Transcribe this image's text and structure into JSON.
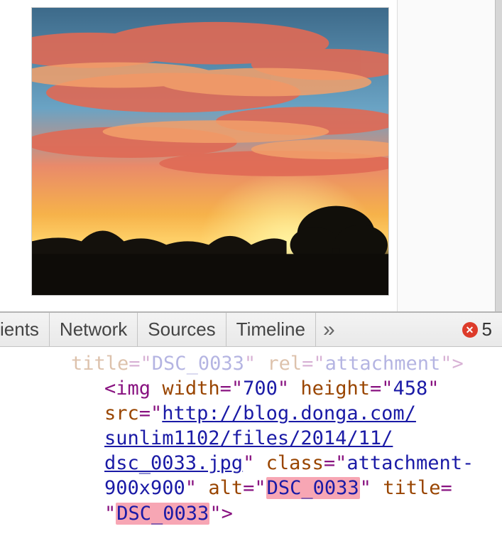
{
  "devtools": {
    "tabs": {
      "cut_prev": "ients",
      "network": "Network",
      "sources": "Sources",
      "timeline": "Timeline"
    },
    "overflow_glyph": "»",
    "error_count": "5"
  },
  "code": {
    "faded_prev_line": {
      "attr1": "title",
      "val1": "DSC_0033",
      "attr2": "rel",
      "val2": "attachment",
      "close": ">"
    },
    "img_open": "<",
    "img_tag": "img",
    "attrs": {
      "width_name": "width",
      "width_val": "700",
      "height_name": "height",
      "height_val": "458",
      "src_name": "src",
      "src_url_line1": "http://blog.donga.com/",
      "src_url_line2": "sunlim1102/files/2014/11/",
      "src_url_line3": "dsc_0033.jpg",
      "class_name": "class",
      "class_val_a": "attachment-",
      "class_val_b": "900x900",
      "alt_name": "alt",
      "alt_val": "DSC_0033",
      "title_name": "title",
      "title_val": "DSC_0033"
    },
    "img_close": ">"
  }
}
